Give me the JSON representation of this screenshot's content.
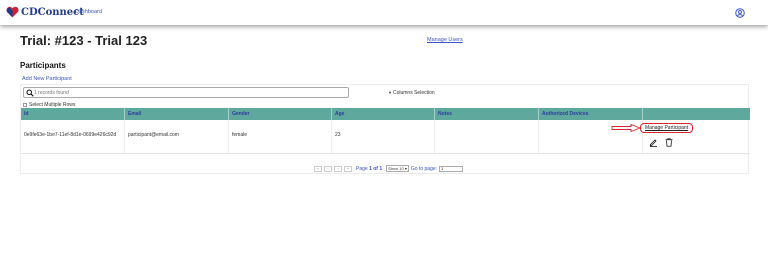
{
  "navbar": {
    "brand": "CDConnect",
    "dashboard_label": "Dashboard"
  },
  "page": {
    "title": "Trial: #123 - Trial 123",
    "manage_users_label": "Manage Users",
    "section_title": "Participants",
    "add_new_label": "Add New Participant"
  },
  "search": {
    "placeholder": "1 records found",
    "columns_selection_label": "Columns Selection",
    "select_multiple_label": "Select Multiple Rows"
  },
  "table": {
    "headers": [
      "Id",
      "Email",
      "Gender",
      "Age",
      "Notes",
      "Authorized Devices",
      ""
    ],
    "rows": [
      {
        "id": "0e9fe63e-1be7-11ef-8d1e-0699e426c92d",
        "email": "participant@email.com",
        "gender": "female",
        "age": "23",
        "notes": "",
        "authorized_devices": "",
        "manage_label": "Manage Participant"
      }
    ]
  },
  "pagination": {
    "page_label": "Page",
    "page_current": "1",
    "of_label": "of",
    "page_total": "1",
    "show_option": "Show 10",
    "goto_label": "Go to page:",
    "goto_value": "1"
  },
  "colors": {
    "brand": "#1f3b8c",
    "link": "#3a54c6",
    "table_header": "#5fa89e",
    "highlight": "#d9262b"
  }
}
